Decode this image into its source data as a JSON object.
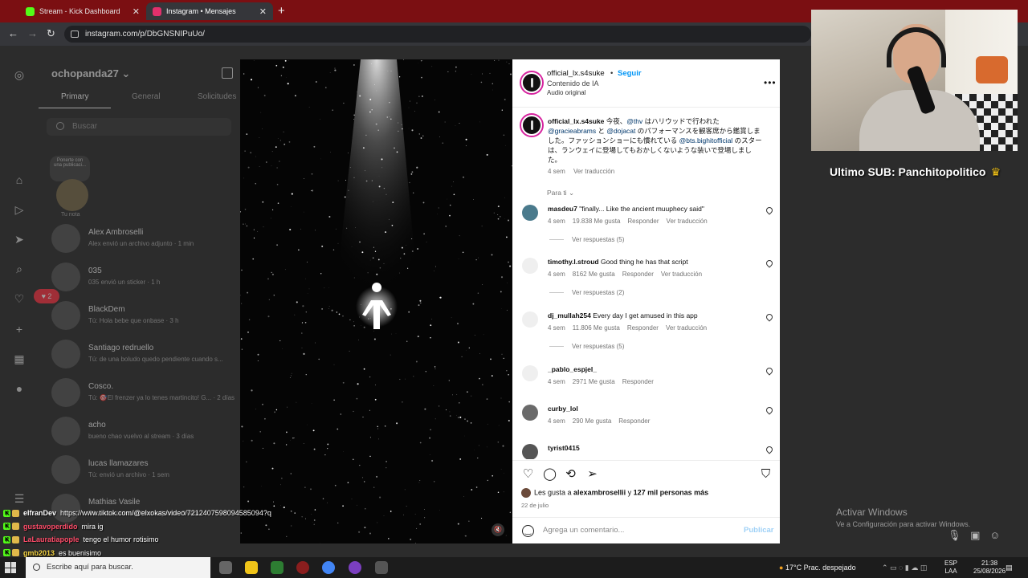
{
  "browser": {
    "tabs": [
      {
        "label": "Stream - Kick Dashboard",
        "color": "#53fc18"
      },
      {
        "label": "Instagram • Mensajes",
        "color": "#e1306c"
      }
    ],
    "url": "instagram.com/p/DbGNSNIPuUo/"
  },
  "inbox": {
    "username": "ochopanda27",
    "tabs": [
      "Primary",
      "General",
      "Solicitudes"
    ],
    "search_placeholder": "Buscar",
    "note_text": "Ponerte con una publicaci...",
    "note_label": "Tu nota",
    "notifications_count": "2",
    "threads": [
      {
        "name": "Alex Ambroselli",
        "preview": "Alex envió un archivo adjunto · 1 min"
      },
      {
        "name": "035",
        "preview": "035 envió un sticker · 1 h"
      },
      {
        "name": "BlackDem",
        "preview": "Tú: Hola bebe que onbase · 3 h"
      },
      {
        "name": "Santiago redruello",
        "preview": "Tú: de una boludo quedo pendiente cuando s..."
      },
      {
        "name": "Cosco.",
        "preview": "Tú: 🎯El frenzer ya lo tenes martincito! G... · 2 días"
      },
      {
        "name": "acho",
        "preview": "bueno chao vuelvo al stream · 3 días"
      },
      {
        "name": "lucas llamazares",
        "preview": "Tú: envió un archivo · 1 sem"
      },
      {
        "name": "Mathias Vasile",
        "preview": "Tú enviaste un archivo adjunto · 3 sem"
      }
    ]
  },
  "post": {
    "author": "official_lx.s4suke",
    "follow_label": "Seguir",
    "ai_label": "Contenido de IA",
    "audio_label": "Audio original",
    "caption": {
      "p1": " 今夜、",
      "m1": "@thv",
      "p2": " はハリウッドで行われた ",
      "m2": "@gracieabrams",
      "p3": " と ",
      "m3": "@dojacat",
      "p4": " のパフォーマンスを観客席から鑑賞しました。ファッションショーにも慣れている ",
      "m4": "@bts.bighitofficial",
      "p5": " のスターは、ランウェイに登場してもおかしくないような装いで登場しました。",
      "time": "4 sem",
      "translate": "Ver traducción"
    },
    "filter_label": "Para ti",
    "comments": [
      {
        "user": "masdeu7",
        "text": "\"finally... Like the ancient muuphecy said\"",
        "time": "4 sem",
        "likes": "19.838 Me gusta",
        "reply": "Responder",
        "translate": "Ver traducción",
        "replies": "Ver respuestas (5)",
        "color": "#4a7a8c"
      },
      {
        "user": "timothy.l.stroud",
        "text": "Good thing he has that script",
        "time": "4 sem",
        "likes": "8162 Me gusta",
        "reply": "Responder",
        "translate": "Ver traducción",
        "replies": "Ver respuestas (2)",
        "color": "#efefef"
      },
      {
        "user": "dj_mullah254",
        "text": "Every day I get amused in this app",
        "time": "4 sem",
        "likes": "11.806 Me gusta",
        "reply": "Responder",
        "translate": "Ver traducción",
        "replies": "Ver respuestas (5)",
        "color": "#efefef"
      },
      {
        "user": "_pablo_espjel_",
        "text": "",
        "time": "4 sem",
        "likes": "2971 Me gusta",
        "reply": "Responder",
        "translate": "",
        "replies": "",
        "color": "#efefef"
      },
      {
        "user": "curby_lol",
        "text": "",
        "time": "4 sem",
        "likes": "290 Me gusta",
        "reply": "Responder",
        "translate": "",
        "replies": "",
        "color": "#6a6a6a"
      },
      {
        "user": "tyrist0415",
        "text": "",
        "time": "",
        "likes": "",
        "reply": "",
        "translate": "",
        "replies": "",
        "color": "#555555"
      }
    ],
    "likes": {
      "prefix": "Les gusta a ",
      "user": "alexambrosellii",
      "mid": " y ",
      "count": "127 mil personas más"
    },
    "date": "22 de julio",
    "comment_placeholder": "Agrega un comentario...",
    "publish_label": "Publicar"
  },
  "stream": {
    "last_sub": "Ultimo SUB: Panchitopolitico",
    "activate_title": "Activar Windows",
    "activate_sub": "Ve a Configuración para activar Windows.",
    "chat": [
      {
        "user": "elfranDev",
        "msg": "https://www.tiktok.com/@elxokas/video/7212407598094585094?q",
        "color": "#ffffff"
      },
      {
        "user": "gustavoperdido",
        "msg": "mira ig",
        "color": "#ff4d6a"
      },
      {
        "user": "LaLauratiapople",
        "msg": "tengo el humor rotisimo",
        "color": "#ff4d6a"
      },
      {
        "user": "gmb2013",
        "msg": "es buenisimo",
        "color": "#f5d442"
      },
      {
        "user": "",
        "msg": "https://www.tiktok.com/@elxokas/video/7212407598094585094?q",
        "color": "#ffffff"
      }
    ]
  },
  "taskbar": {
    "search_placeholder": "Escribe aquí para buscar.",
    "weather": "17°C  Prac. despejado",
    "lang_top": "ESP",
    "lang_bottom": "LAA",
    "time": "21:38",
    "date": "25/08/2026"
  }
}
